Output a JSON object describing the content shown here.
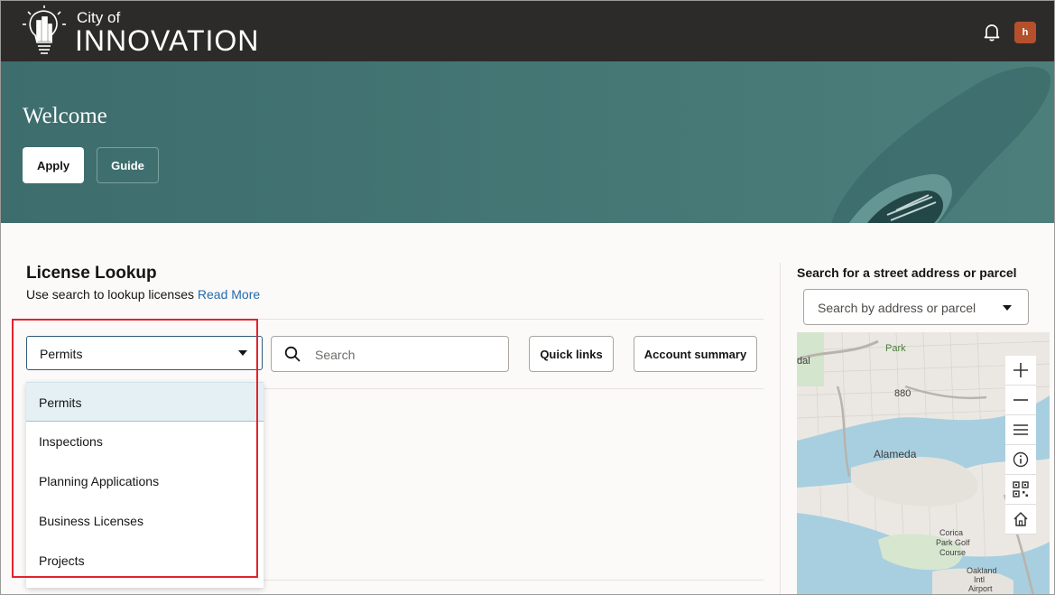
{
  "header": {
    "logo_small": "City of",
    "logo_big": "INNOVATION",
    "avatar_initial": "h",
    "icons": {
      "logo": "lightbulb-city-icon",
      "notifications": "bell-icon"
    }
  },
  "hero": {
    "title": "Welcome",
    "apply_label": "Apply",
    "guide_label": "Guide"
  },
  "license": {
    "title": "License Lookup",
    "subtitle": "Use search to lookup licenses",
    "read_more": "Read More",
    "selected_type": "Permits",
    "search_placeholder": "Search",
    "quick_links_label": "Quick links",
    "account_summary_label": "Account summary",
    "options": [
      "Permits",
      "Inspections",
      "Planning Applications",
      "Business Licenses",
      "Projects"
    ]
  },
  "map_panel": {
    "title": "Search for a street address or parcel",
    "address_placeholder": "Search by address or parcel",
    "labels": {
      "park": "Park",
      "dal": "dal",
      "alameda": "Alameda",
      "road880": "880",
      "corica": "Corica",
      "park_golf": "Park Golf",
      "course": "Course",
      "oakland": "Oakland",
      "intl": "Intl",
      "airport": "Airport"
    },
    "tools": [
      "zoom-in-icon",
      "zoom-out-icon",
      "layers-list-icon",
      "info-icon",
      "qr-code-icon",
      "home-icon"
    ]
  },
  "colors": {
    "topbar": "#2d2b2a",
    "hero": "#457775",
    "link": "#226bab",
    "highlight_box": "#e1242c",
    "avatar": "#b5502c"
  }
}
